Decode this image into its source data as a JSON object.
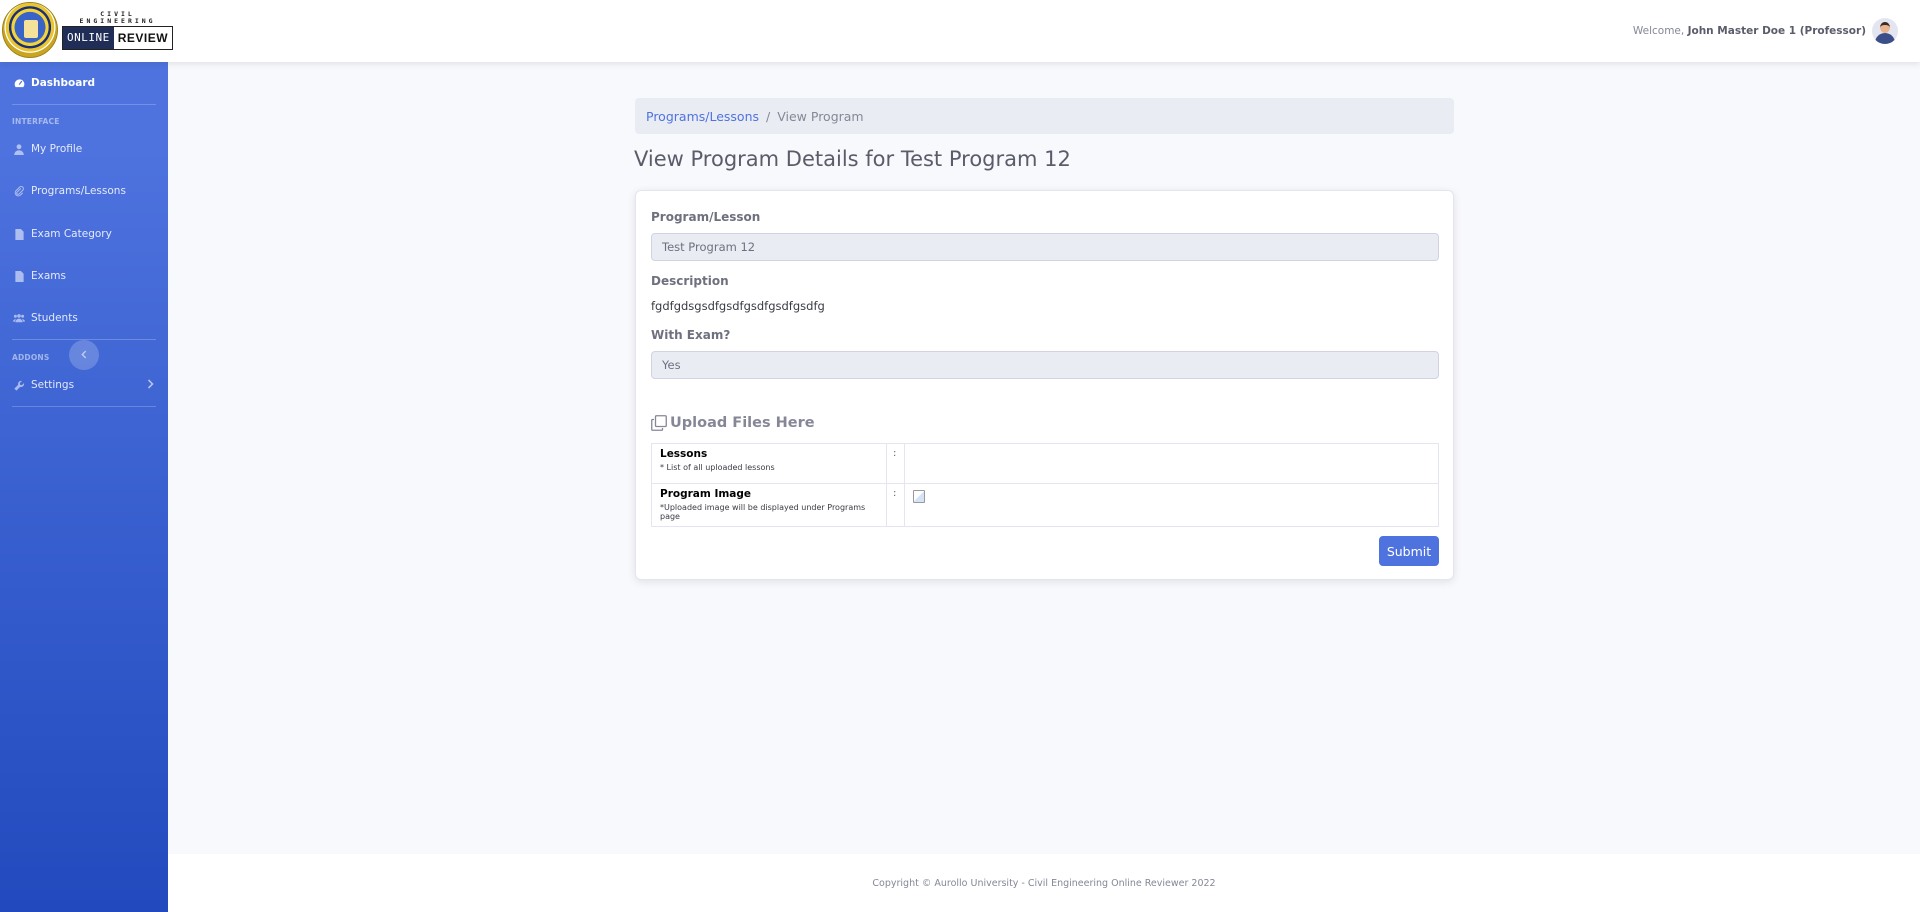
{
  "header": {
    "logo": {
      "brand_top": "CIVIL ENGINEERING",
      "brand_left": "ONLINE",
      "brand_right": "REVIEW"
    },
    "welcome_prefix": "Welcome,",
    "user_name": "John Master Doe 1 (Professor)"
  },
  "sidebar": {
    "dashboard": {
      "label": "Dashboard",
      "icon": "tachometer-icon"
    },
    "heading_interface": "INTERFACE",
    "items": [
      {
        "label": "My Profile",
        "icon": "user-icon"
      },
      {
        "label": "Programs/Lessons",
        "icon": "paperclip-icon"
      },
      {
        "label": "Exam Category",
        "icon": "document-icon"
      },
      {
        "label": "Exams",
        "icon": "document-icon"
      },
      {
        "label": "Students",
        "icon": "users-icon"
      }
    ],
    "heading_addons": "ADDONS",
    "settings": {
      "label": "Settings",
      "icon": "wrench-icon"
    },
    "toggle_icon": "chevron-left-icon"
  },
  "breadcrumb": {
    "link": "Programs/Lessons",
    "separator": "/",
    "current": "View Program"
  },
  "page_title": "View Program Details for Test Program 12",
  "form": {
    "program_label": "Program/Lesson",
    "program_value": "Test Program 12",
    "description_label": "Description",
    "description_value": "fgdfgdsgsdfgsdfgsdfgsdfgsdfg",
    "with_exam_label": "With Exam?",
    "with_exam_value": "Yes",
    "upload_title": "Upload Files Here",
    "rows": [
      {
        "title": "Lessons",
        "note": "* List of all uploaded lessons",
        "sep": ":"
      },
      {
        "title": "Program Image",
        "note": "*Uploaded image will be displayed under Programs page",
        "sep": ":"
      }
    ],
    "submit_label": "Submit"
  },
  "footer": {
    "text": "Copyright © Aurollo University - Civil Engineering Online Reviewer 2022"
  },
  "colors": {
    "primary": "#4e73df",
    "sidebar_end": "#224abe",
    "background": "#f8f9fc"
  }
}
